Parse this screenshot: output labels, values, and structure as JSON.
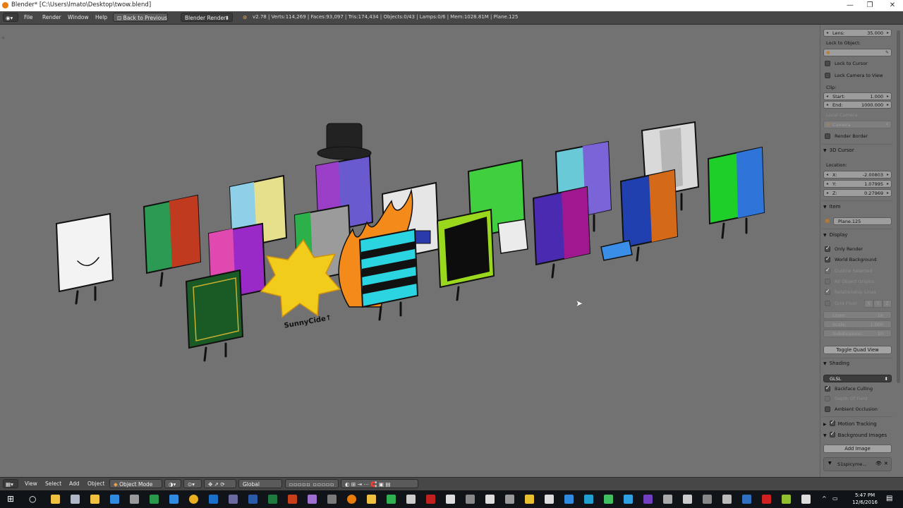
{
  "window": {
    "title": "Blender* [C:\\Users\\lmato\\Desktop\\twow.blend]"
  },
  "header": {
    "menus": [
      "File",
      "Render",
      "Window",
      "Help"
    ],
    "back_button": "Back to Previous",
    "render_engine": "Blender Render",
    "stats": "v2.78 | Verts:114,269 | Faces:93,097 | Tris:174,434 | Objects:0/43 | Lamps:0/6 | Mem:1028.81M | Plane.125"
  },
  "panel": {
    "lens": {
      "label": "Lens:",
      "value": "35.000"
    },
    "lock_to_object_label": "Lock to Object:",
    "lock_to_cursor": "Lock to Cursor",
    "lock_camera_to_view": "Lock Camera to View",
    "clip_label": "Clip:",
    "clip_start": {
      "label": "Start:",
      "value": "1.000"
    },
    "clip_end": {
      "label": "End:",
      "value": "1000.000"
    },
    "local_camera_label": "Local Camera",
    "local_camera_value": "Camera",
    "render_border": "Render Border",
    "cursor_section": "3D Cursor",
    "location_label": "Location:",
    "cursor_x": {
      "label": "X:",
      "value": "-2.00803"
    },
    "cursor_y": {
      "label": "Y:",
      "value": "1.07995"
    },
    "cursor_z": {
      "label": "Z:",
      "value": "0.27969"
    },
    "item_section": "Item",
    "item_name": "Plane.125",
    "display_section": "Display",
    "only_render": "Only Render",
    "world_background": "World Background",
    "outline_selected": "Outline Selected",
    "all_object_origins": "All Object Origins",
    "relationship_lines": "Relationship Lines",
    "grid_floor": "Grid Floor",
    "grid_axes": [
      "X",
      "Y",
      "Z"
    ],
    "lines": {
      "label": "Lines:",
      "value": "16"
    },
    "scale": {
      "label": "Scale:",
      "value": "1.000"
    },
    "subdivisions": {
      "label": "Subdivisions:",
      "value": "10"
    },
    "toggle_quad_view": "Toggle Quad View",
    "shading_section": "Shading",
    "shading_mode": "GLSL",
    "backface_culling": "Backface Culling",
    "depth_of_field": "Depth Of Field",
    "ambient_occlusion": "Ambient Occlusion",
    "motion_tracking": "Motion Tracking",
    "background_images": "Background Images",
    "add_image": "Add Image",
    "bg_image_name": "S1spicyme..."
  },
  "footer": {
    "menus": [
      "View",
      "Select",
      "Add",
      "Object"
    ],
    "mode": "Object Mode",
    "orientation": "Global"
  },
  "scene": {
    "sunny_label": "SunnyCide↑"
  },
  "taskbar": {
    "time": "5:47 PM",
    "date": "12/6/2016"
  }
}
